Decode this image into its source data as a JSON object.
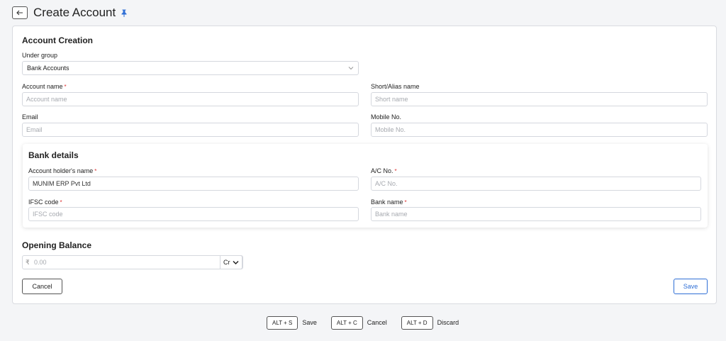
{
  "header": {
    "title": "Create Account",
    "back_icon": "arrow-left-icon",
    "pin_icon": "pin-icon",
    "accent": "#2f6fd6"
  },
  "account_creation": {
    "title": "Account Creation",
    "under_group": {
      "label": "Under group",
      "value": "Bank Accounts"
    },
    "account_name": {
      "label": "Account name",
      "required": "*",
      "placeholder": "Account name"
    },
    "short_alias": {
      "label": "Short/Alias name",
      "placeholder": "Short name"
    },
    "email": {
      "label": "Email",
      "placeholder": "Email"
    },
    "mobile": {
      "label": "Mobile No.",
      "placeholder": "Mobile No."
    }
  },
  "bank_details": {
    "title": "Bank details",
    "holder_name": {
      "label": "Account holder's name",
      "required": "*",
      "value": "MUNIM ERP Pvt Ltd"
    },
    "ac_no": {
      "label": "A/C No.",
      "required": "*",
      "placeholder": "A/C No."
    },
    "ifsc": {
      "label": "IFSC code",
      "required": "*",
      "placeholder": "IFSC code"
    },
    "bank_name": {
      "label": "Bank name",
      "required": "*",
      "placeholder": "Bank name"
    }
  },
  "opening_balance": {
    "title": "Opening Balance",
    "currency_symbol": "₹",
    "placeholder": "0.00",
    "type_value": "Cr"
  },
  "actions": {
    "cancel": "Cancel",
    "save": "Save"
  },
  "shortcuts": [
    {
      "keys": "ALT + S",
      "label": "Save"
    },
    {
      "keys": "ALT + C",
      "label": "Cancel"
    },
    {
      "keys": "ALT + D",
      "label": "Discard"
    }
  ]
}
